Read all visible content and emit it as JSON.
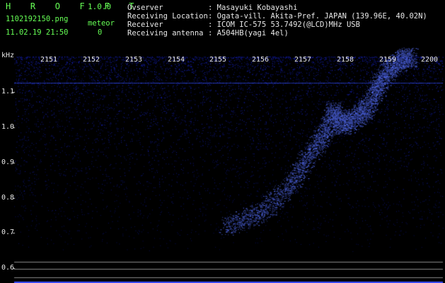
{
  "app": {
    "name": "H R O F F T",
    "version": "1.0.0"
  },
  "file": {
    "name": "1102192150.png",
    "datetime": "11.02.19 21:50"
  },
  "meteor": {
    "label": "meteor",
    "count": "0"
  },
  "info": [
    {
      "key": "Ovserver",
      "value": ": Masayuki Kobayashi"
    },
    {
      "key": "Receiving Location",
      "value": ": Ogata-vill. Akita-Pref. JAPAN (139.96E, 40.02N)"
    },
    {
      "key": "Receiver",
      "value": ": ICOM IC-575 53.7492(@LCD)MHz USB"
    },
    {
      "key": "Receiving antenna",
      "value": ": A504HB(yagi 4el)"
    }
  ],
  "axis": {
    "unit": "kHz",
    "y_labels": [
      "1.1",
      "1.0",
      "0.9",
      "0.8",
      "0.7",
      "0.6"
    ],
    "x_labels": [
      "2151",
      "2152",
      "2153",
      "2154",
      "2155",
      "2156",
      "2157",
      "2158",
      "2159",
      "2200"
    ]
  },
  "colors": {
    "header_green": "#66ff55",
    "label_white": "#e8e8e8",
    "signal_blue": "#3a4cff",
    "background": "#000000"
  }
}
